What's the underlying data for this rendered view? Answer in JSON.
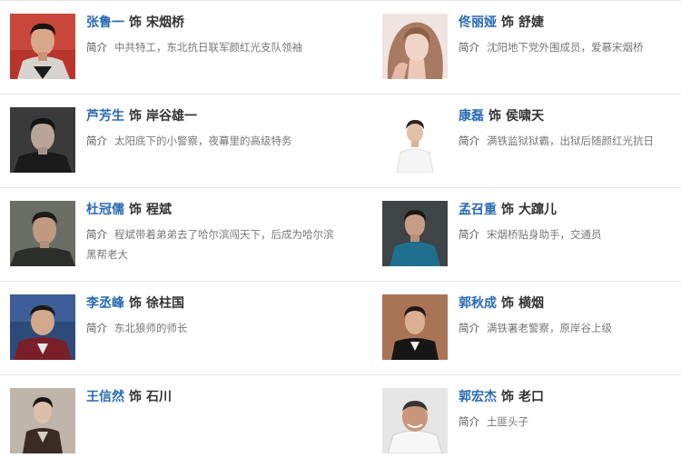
{
  "connector": "饰",
  "desc_label": "简介",
  "cast": [
    {
      "actor": "张鲁一",
      "role": "宋烟桥",
      "desc": "中共特工，东北抗日联军颜红光支队领袖"
    },
    {
      "actor": "佟丽娅",
      "role": "舒婕",
      "desc": "沈阳地下党外围成员，爱慕宋烟桥"
    },
    {
      "actor": "芦芳生",
      "role": "岸谷雄一",
      "desc": "太阳底下的小警察，夜幕里的高级特务"
    },
    {
      "actor": "康磊",
      "role": "侯啸天",
      "desc": "满铁监狱狱霸，出狱后随颜红光抗日"
    },
    {
      "actor": "杜冠儒",
      "role": "程斌",
      "desc": "程斌带着弟弟去了哈尔滨闯天下，后成为哈尔滨黑帮老大"
    },
    {
      "actor": "孟召重",
      "role": "大蹿儿",
      "desc": "宋烟桥贴身助手，交通员"
    },
    {
      "actor": "李丞峰",
      "role": "徐柱国",
      "desc": "东北狼师的师长"
    },
    {
      "actor": "郭秋成",
      "role": "横烟",
      "desc": "满铁署老警察，原岸谷上级"
    },
    {
      "actor": "王信然",
      "role": "石川",
      "desc": ""
    },
    {
      "actor": "郭宏杰",
      "role": "老口",
      "desc": "土匪头子"
    }
  ]
}
